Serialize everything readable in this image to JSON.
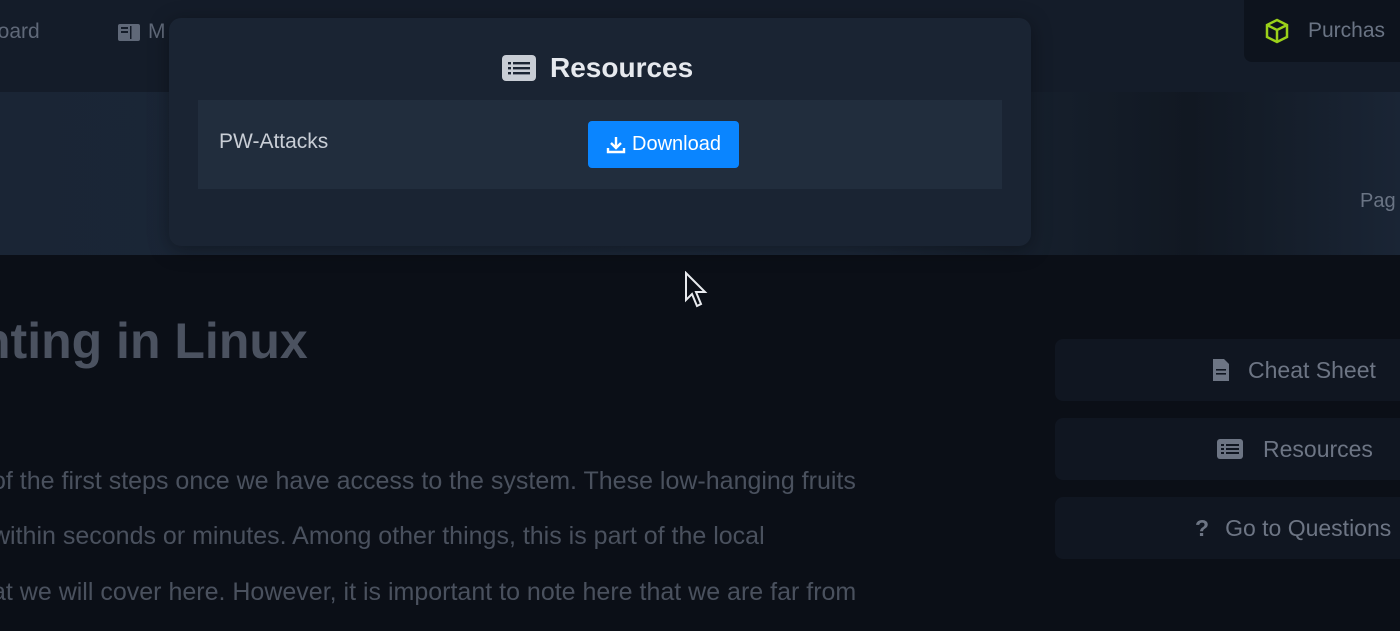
{
  "nav": {
    "dashboard_label": "board",
    "modules_label": "M",
    "purchase_label": "Purchas"
  },
  "hero": {
    "page_label": "Pag"
  },
  "popup": {
    "title": "Resources",
    "items": [
      {
        "name": "PW-Attacks",
        "button_label": "Download"
      }
    ]
  },
  "content": {
    "heading": "nting in Linux",
    "lines": [
      "of the first steps once we have access to the system. These low-hanging fruits",
      "within seconds or minutes. Among other things, this is part of the local",
      "at we will cover here. However, it is important to note here that we are far from"
    ]
  },
  "sidebar": {
    "cheat_sheet": "Cheat Sheet",
    "resources": "Resources",
    "questions": "Go to Questions",
    "questions_icon": "?"
  },
  "colors": {
    "accent": "#0a85ff",
    "cube": "#9bd11a"
  }
}
